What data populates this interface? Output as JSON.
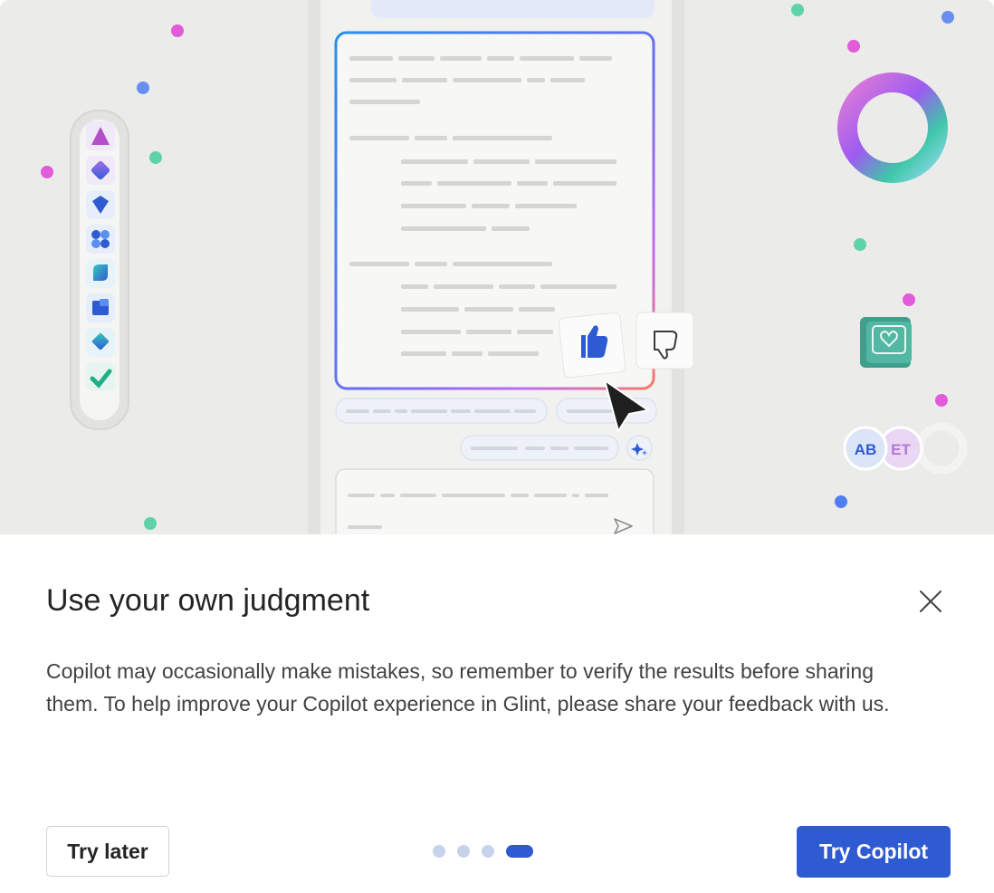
{
  "dialog": {
    "title": "Use your own judgment",
    "description": "Copilot may occasionally make mistakes, so remember to verify the results before sharing them. To help improve your Copilot experience in Glint, please share your feedback with us.",
    "close_icon": "close-icon"
  },
  "illustration": {
    "avatar_initials": [
      "AB",
      "ET"
    ],
    "icons": [
      "thumbs-up-icon",
      "thumbs-down-icon",
      "send-icon",
      "sparkle-icon",
      "heart-icon",
      "cursor-icon",
      "donut-ring-icon"
    ],
    "app_icons": [
      "app-icon-1",
      "app-icon-2",
      "app-icon-3",
      "app-icon-4",
      "app-icon-5",
      "app-icon-6",
      "app-icon-7",
      "app-icon-8"
    ]
  },
  "footer": {
    "try_later_label": "Try later",
    "try_copilot_label": "Try Copilot",
    "pager": {
      "count": 4,
      "active_index": 3
    }
  },
  "colors": {
    "primary": "#2f5bd2",
    "title_text": "#242424",
    "body_text": "#424242",
    "hero_background": "#ededeb",
    "pager_inactive": "#c7d3ec"
  }
}
